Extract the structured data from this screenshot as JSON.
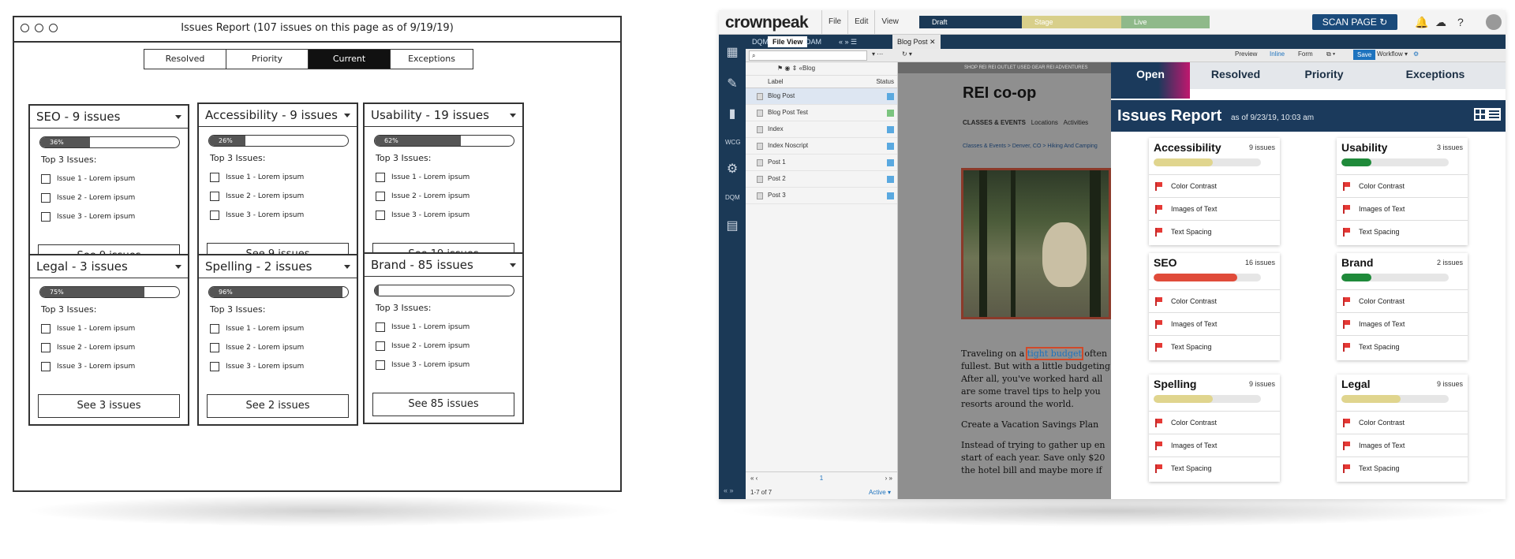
{
  "wireframe": {
    "title": "Issues Report (107 issues on this page as of 9/19/19)",
    "tabs": [
      "Resolved",
      "Priority",
      "Current",
      "Exceptions"
    ],
    "active_tab": "Current",
    "top3_label": "Top 3 Issues:",
    "cards": [
      {
        "title": "SEO - 9 issues",
        "progress_label": "36%",
        "progress": 0.36,
        "issues": [
          "Issue 1 - Lorem ipsum",
          "Issue 2 - Lorem ipsum",
          "Issue 3 - Lorem ipsum"
        ],
        "see": "See 9 issues"
      },
      {
        "title": "Accessibility - 9 issues",
        "progress_label": "26%",
        "progress": 0.26,
        "issues": [
          "Issue 1 - Lorem ipsum",
          "Issue 2 - Lorem ipsum",
          "Issue 3 - Lorem ipsum"
        ],
        "see": "See 9 issues"
      },
      {
        "title": "Usability - 19 issues",
        "progress_label": "62%",
        "progress": 0.62,
        "issues": [
          "Issue 1 - Lorem ipsum",
          "Issue 2 - Lorem ipsum",
          "Issue 3 - Lorem ipsum"
        ],
        "see": "See 19 issues"
      },
      {
        "title": "Legal - 3 issues",
        "progress_label": "75%",
        "progress": 0.75,
        "issues": [
          "Issue 1 - Lorem ipsum",
          "Issue 2 - Lorem ipsum",
          "Issue 3 - Lorem ipsum"
        ],
        "see": "See 3 issues"
      },
      {
        "title": "Spelling - 2 issues",
        "progress_label": "96%",
        "progress": 0.96,
        "issues": [
          "Issue 1 - Lorem ipsum",
          "Issue 2 - Lorem ipsum",
          "Issue 3 - Lorem ipsum"
        ],
        "see": "See 2 issues"
      },
      {
        "title": "Brand - 85 issues",
        "progress_label": "3%",
        "progress": 0.03,
        "issues": [
          "Issue 1 - Lorem ipsum",
          "Issue 2 - Lorem ipsum",
          "Issue 3 - Lorem ipsum"
        ],
        "see": "See 85 issues"
      }
    ]
  },
  "app": {
    "logo": "crownpeak",
    "menu": [
      "File",
      "Edit",
      "View"
    ],
    "workflow_steps": [
      "Draft",
      "Stage",
      "Live"
    ],
    "scan_button": "SCAN PAGE",
    "top_icons": [
      "bell-icon",
      "cloud-icon",
      "help-icon",
      "user-icon"
    ],
    "rail_icons": [
      "panels-icon",
      "edit-icon",
      "chart-icon",
      "wcg-icon",
      "gear-icon",
      "dqm-icon",
      "apps-icon"
    ],
    "tabs": [
      "DQM",
      "File View",
      "DAM"
    ],
    "selected_tab": "File View",
    "doc_tab": "Blog Post",
    "toolbar": {
      "preview": "Preview",
      "inline": "Inline",
      "form": "Form",
      "save": "Save",
      "workflow": "Workflow"
    },
    "breadcrumb": "Blog",
    "columns": {
      "label": "Label",
      "status": "Status"
    },
    "files": [
      "Blog Post",
      "Blog Post Test",
      "Index",
      "Index Noscript",
      "Post 1",
      "Post 2",
      "Post 3"
    ],
    "pager": "1",
    "count": "1-7 of 7",
    "filter": "Active"
  },
  "preview": {
    "nav": "SHOP REI   REI OUTLET   USED GEAR   REI ADVENTURES",
    "logo": "REI co-op",
    "menu": [
      "CLASSES & EVENTS",
      "Locations",
      "Activities"
    ],
    "crumb": "Classes & Events  >  Denver, CO  >  Hiking And Camping",
    "body_before": "Traveling on a ",
    "body_highlight": "tight budget",
    "body_after": " often fullest. But with a little budgeting After all, you've worked hard all are some travel tips to help you resorts around the world.",
    "heading": "Create a Vacation Savings Plan",
    "body2": "Instead of trying to gather up en start of each year. Save only $20 the hotel bill and maybe more if"
  },
  "report": {
    "tabs": [
      "Open",
      "Resolved",
      "Priority",
      "Exceptions"
    ],
    "active_tab": "Open",
    "title": "Issues Report",
    "as_of": "as of 9/23/19, 10:03 am",
    "cards": [
      {
        "title": "Accessibility",
        "count": "9 issues",
        "progress": 0.55,
        "color": "#e0d58e",
        "items": [
          "Color Contrast",
          "Images of Text",
          "Text Spacing"
        ]
      },
      {
        "title": "Usability",
        "count": "3 issues",
        "progress": 0.28,
        "color": "#1f8a3a",
        "items": [
          "Color Contrast",
          "Images of Text",
          "Text Spacing"
        ]
      },
      {
        "title": "SEO",
        "count": "16 issues",
        "progress": 0.78,
        "color": "#e04b3a",
        "items": [
          "Color Contrast",
          "Images of Text",
          "Text Spacing"
        ]
      },
      {
        "title": "Brand",
        "count": "2 issues",
        "progress": 0.28,
        "color": "#1f8a3a",
        "items": [
          "Color Contrast",
          "Images of Text",
          "Text Spacing"
        ]
      },
      {
        "title": "Spelling",
        "count": "9 issues",
        "progress": 0.55,
        "color": "#e0d58e",
        "items": [
          "Color Contrast",
          "Images of Text",
          "Text Spacing"
        ]
      },
      {
        "title": "Legal",
        "count": "9 issues",
        "progress": 0.55,
        "color": "#e0d58e",
        "items": [
          "Color Contrast",
          "Images of Text",
          "Text Spacing"
        ]
      }
    ]
  }
}
